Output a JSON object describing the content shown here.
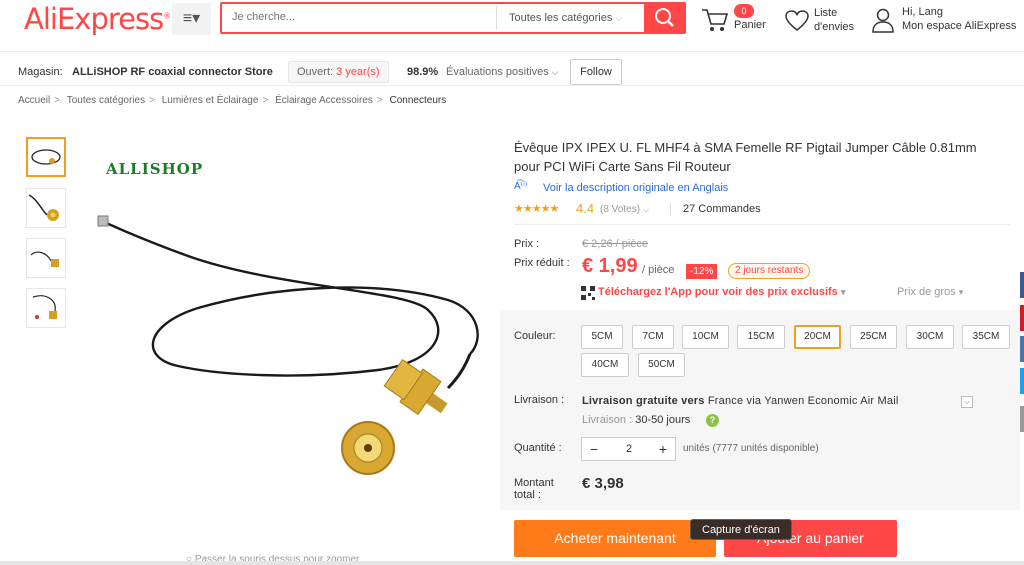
{
  "header": {
    "logo": "AliExpress",
    "search_placeholder": "Je cherche...",
    "search_category": "Toutes les catégories",
    "cart_count": "0",
    "cart_label": "Panier",
    "wishlist_label": "Liste d'envies",
    "user_greeting": "Hi, Lang",
    "user_space": "Mon espace AliExpress"
  },
  "store": {
    "label": "Magasin:",
    "name": "ALLiSHOP RF coaxial connector Store",
    "open_label": "Ouvert:",
    "open_years": "3 year(s)",
    "rating": "98.9%",
    "rating_label": "Évaluations positives",
    "follow": "Follow"
  },
  "breadcrumb": [
    "Accueil",
    "Toutes catégories",
    "Lumières et Éclairage",
    "Éclairage Accessoires",
    "Connecteurs"
  ],
  "gallery": {
    "brand_watermark": "ALLISHOP",
    "zoom_hint": "Passer la souris dessus pour zoomer"
  },
  "product": {
    "title": "Évêque IPX IPEX U. FL MHF4 à SMA Femelle RF Pigtail Jumper Câble 0.81mm pour PCI WiFi Carte Sans Fil Routeur",
    "translate_link": "Voir la description originale en Anglais",
    "stars": "★★★★★",
    "rating": "4.4",
    "votes": "(8 Votes)",
    "orders": "27 Commandes",
    "price_label": "Prix :",
    "price_original": "€ 2,26 / pièce",
    "price_reduced_label": "Prix réduit :",
    "price_current": "€ 1,99",
    "price_unit": "/ pièce",
    "discount": "-12%",
    "days_left": "2 jours restants",
    "app_promo": "Téléchargez l'App pour voir des prix exclusifs",
    "bulk_price": "Prix de gros",
    "color_label": "Couleur:",
    "colors": [
      "5CM",
      "7CM",
      "10CM",
      "15CM",
      "20CM",
      "25CM",
      "30CM",
      "35CM",
      "40CM",
      "50CM"
    ],
    "selected_color": "20CM",
    "delivery_label": "Livraison :",
    "delivery_free": "Livraison gratuite vers",
    "delivery_dest": "France via Yanwen Economic Air Mail",
    "delivery_time_label": "Livraison :",
    "delivery_time": "30-50 jours",
    "qty_label": "Quantité :",
    "qty_value": "2",
    "qty_available": "unités (7777 unités disponible)",
    "total_label": "Montant total :",
    "total_value": "€ 3,98",
    "buy_now": "Acheter maintenant",
    "add_to_cart": "Ajouter au panier",
    "screenshot_tooltip": "Capture d'écran"
  },
  "colors": {
    "brand_red": "#ff4747",
    "orange": "#ff7b1a",
    "star": "#f0a020",
    "link_blue": "#2a6bd8"
  }
}
